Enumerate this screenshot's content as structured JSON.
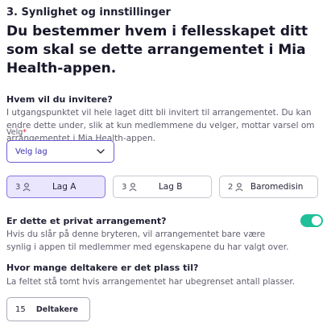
{
  "section": {
    "heading": "3. Synlighet og innstillinger"
  },
  "main": {
    "title": "Du bestemmer hvem i fellesskapet ditt som skal se dette arrangementet i Mia Health-appen."
  },
  "invite": {
    "question": "Hvem vil du invitere?",
    "description": "I utgangspunktet vil hele laget ditt bli invitert til arrangementet. Du kan endre dette under, slik at kun medlemmene du velger, mottar varsel om arrangementet i Mia Health-appen.",
    "select_label": "Velg",
    "required_mark": "*",
    "select_value": "Velg lag"
  },
  "teams": [
    {
      "count": "3",
      "name": "Lag A",
      "selected": true
    },
    {
      "count": "3",
      "name": "Lag B",
      "selected": false
    },
    {
      "count": "2",
      "name": "Baromedisin",
      "selected": false
    }
  ],
  "private": {
    "question": "Er dette et privat arrangement?",
    "description": "Hvis du slår på denne bryteren, vil arrangementet bare være synlig i appen til medlemmer med egenskapene du har valgt over.",
    "toggle_on": true
  },
  "capacity": {
    "question": "Hvor mange deltakere er det plass til?",
    "description": "La feltet stå tomt hvis arrangementet har ubegrenset antall plasser.",
    "value": "15",
    "unit": "Deltakere"
  },
  "colors": {
    "accent": "#6b5bd6",
    "selected_bg": "#e9e6fd",
    "toggle_on": "#1fbf9a",
    "required": "#d6203a"
  }
}
